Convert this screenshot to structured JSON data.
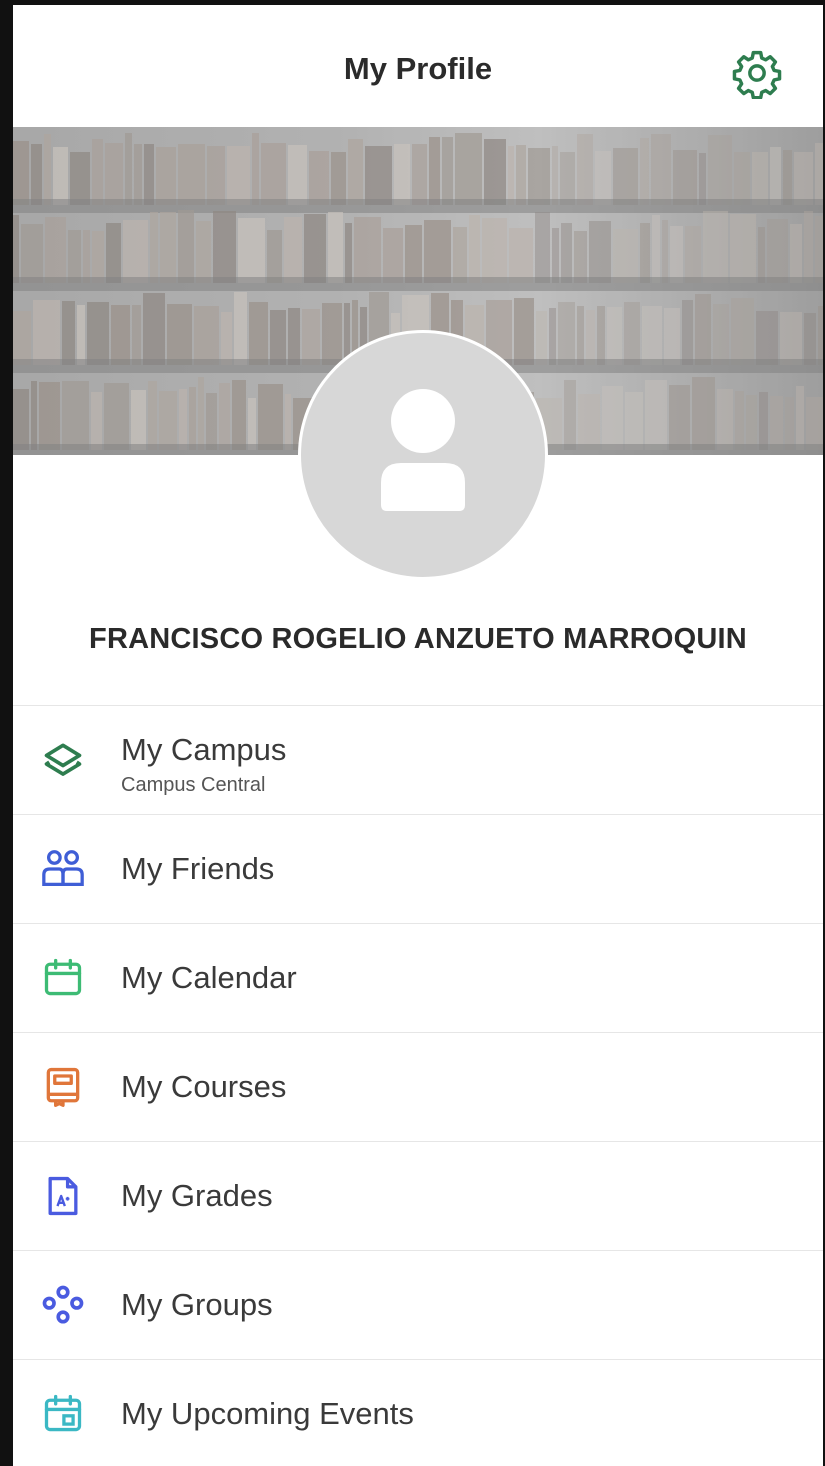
{
  "header": {
    "title": "My Profile",
    "settings_icon": "gear-icon"
  },
  "profile": {
    "name": "FRANCISCO ROGELIO ANZUETO MARROQUIN",
    "avatar_icon": "user-icon"
  },
  "menu": {
    "items": [
      {
        "label": "My Campus",
        "sublabel": "Campus Central",
        "icon": "layers-icon",
        "color": "#2e7d4f"
      },
      {
        "label": "My Friends",
        "icon": "friends-icon",
        "color": "#3f5ed6"
      },
      {
        "label": "My Calendar",
        "icon": "calendar-icon",
        "color": "#3dbb74"
      },
      {
        "label": "My Courses",
        "icon": "book-icon",
        "color": "#e0763a"
      },
      {
        "label": "My Grades",
        "icon": "grade-document-icon",
        "color": "#4a5be0"
      },
      {
        "label": "My Groups",
        "icon": "groups-icon",
        "color": "#4a5be0"
      },
      {
        "label": "My Upcoming Events",
        "icon": "event-calendar-icon",
        "color": "#3bb8c4"
      }
    ]
  },
  "colors": {
    "accent": "#2e7d4f",
    "divider": "#e6e6e6",
    "avatar_bg": "#d7d7d7"
  }
}
